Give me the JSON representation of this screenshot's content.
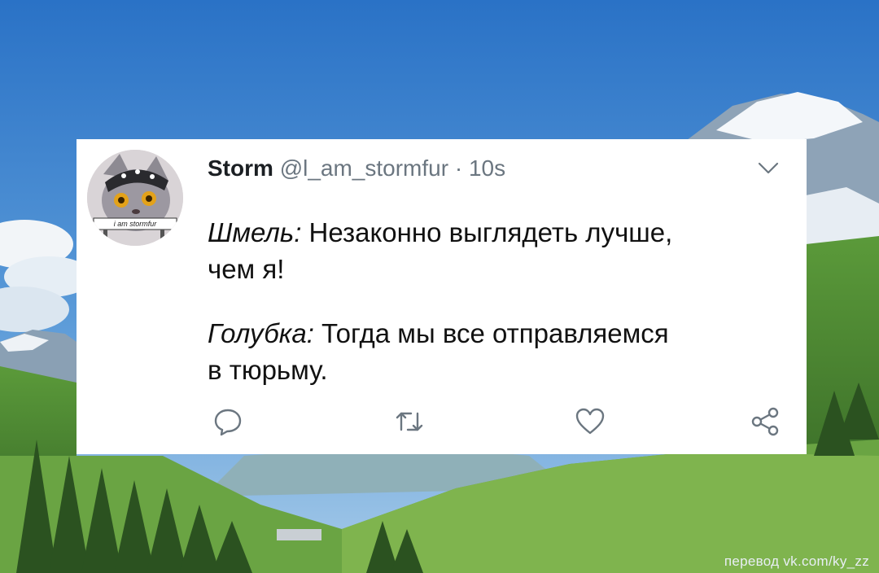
{
  "tweet": {
    "display_name": "Storm",
    "handle": "@l_am_stormfur",
    "separator": "·",
    "time": "10s",
    "avatar_text": "i am stormfur",
    "lines": [
      {
        "speaker": "Шмель:",
        "text": " Незаконно выглядеть лучше,"
      },
      {
        "speaker": "",
        "text": "чем я!"
      },
      {
        "speaker": "Голубка:",
        "text": " Тогда мы все отправляемся"
      },
      {
        "speaker": "",
        "text": "в тюрьму."
      }
    ]
  },
  "actions": {
    "reply": "reply-icon",
    "retweet": "retweet-icon",
    "like": "heart-icon",
    "share": "share-icon"
  },
  "watermark": "перевод vk.com/ky_zz",
  "colors": {
    "sky_top": "#2f78c9",
    "sky_bottom": "#9cc6ea",
    "forest": "#3f7a2c",
    "text": "#111111",
    "meta": "#6b7680",
    "icon": "#6b7680"
  }
}
